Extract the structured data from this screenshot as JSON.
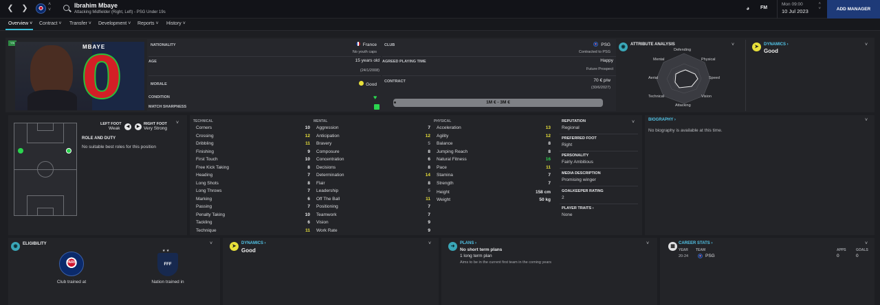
{
  "topbar": {
    "player_name": "Ibrahim Mbaye",
    "player_sub": "Attacking Midfielder (Right, Left) - PSG Under 19s",
    "fm_label": "FM",
    "date_day": "Mon 09:00",
    "date": "10 Jul 2023",
    "add_manager": "ADD MANAGER"
  },
  "menu": [
    "Overview",
    "Contract",
    "Transfer",
    "Development",
    "Reports",
    "History"
  ],
  "kit": {
    "name": "MBAYE",
    "number": "0",
    "badge": "Yth"
  },
  "info": {
    "nationality_label": "NATIONALITY",
    "nationality": "France",
    "nationality_sub": "No youth caps",
    "age_label": "AGE",
    "age": "15 years old",
    "dob": "(24/1/2008)",
    "morale_label": "MORALE",
    "morale": "Good",
    "condition_label": "CONDITION",
    "sharpness_label": "MATCH SHARPNESS",
    "club_label": "CLUB",
    "club": "PSG",
    "club_sub": "Contracted to PSG",
    "playing_time_label": "AGREED PLAYING TIME",
    "playing_time": "Happy",
    "playing_time_sub": "Future Prospect",
    "contract_label": "CONTRACT",
    "wage": "70 € p/w",
    "contract_end": "(30/6/2027)",
    "value_range": "1M € - 3M €"
  },
  "attribute_analysis": {
    "title": "ATTRIBUTE ANALYSIS",
    "labels": [
      "Defending",
      "Physical",
      "Speed",
      "Vision",
      "Attacking",
      "Technical",
      "Aerial",
      "Mental"
    ]
  },
  "dynamics_top": {
    "title": "DYNAMICS",
    "value": "Good"
  },
  "positions": {
    "left_foot_label": "LEFT FOOT",
    "left_foot": "Weak",
    "right_foot_label": "RIGHT FOOT",
    "right_foot": "Very Strong",
    "role_title": "ROLE AND DUTY",
    "role_text": "No suitable best roles for this position"
  },
  "technical": {
    "title": "TECHNICAL",
    "rows": [
      [
        "Corners",
        "10"
      ],
      [
        "Crossing",
        "12"
      ],
      [
        "Dribbling",
        "11"
      ],
      [
        "Finishing",
        "9"
      ],
      [
        "First Touch",
        "10"
      ],
      [
        "Free Kick Taking",
        "8"
      ],
      [
        "Heading",
        "7"
      ],
      [
        "Long Shots",
        "8"
      ],
      [
        "Long Throws",
        "7"
      ],
      [
        "Marking",
        "6"
      ],
      [
        "Passing",
        "7"
      ],
      [
        "Penalty Taking",
        "10"
      ],
      [
        "Tackling",
        "6"
      ],
      [
        "Technique",
        "11"
      ]
    ]
  },
  "mental": {
    "title": "MENTAL",
    "rows": [
      [
        "Aggression",
        "7"
      ],
      [
        "Anticipation",
        "12"
      ],
      [
        "Bravery",
        "5"
      ],
      [
        "Composure",
        "8"
      ],
      [
        "Concentration",
        "6"
      ],
      [
        "Decisions",
        "8"
      ],
      [
        "Determination",
        "14"
      ],
      [
        "Flair",
        "8"
      ],
      [
        "Leadership",
        "5"
      ],
      [
        "Off The Ball",
        "11"
      ],
      [
        "Positioning",
        "7"
      ],
      [
        "Teamwork",
        "7"
      ],
      [
        "Vision",
        "9"
      ],
      [
        "Work Rate",
        "9"
      ]
    ]
  },
  "physical": {
    "title": "PHYSICAL",
    "rows": [
      [
        "Acceleration",
        "13"
      ],
      [
        "Agility",
        "12"
      ],
      [
        "Balance",
        "8"
      ],
      [
        "Jumping Reach",
        "8"
      ],
      [
        "Natural Fitness",
        "16"
      ],
      [
        "Pace",
        "11"
      ],
      [
        "Stamina",
        "7"
      ],
      [
        "Strength",
        "7"
      ]
    ],
    "height_label": "Height",
    "height": "158 cm",
    "weight_label": "Weight",
    "weight": "50 kg"
  },
  "profile": {
    "reputation_label": "REPUTATION",
    "reputation": "Regional",
    "pref_foot_label": "PREFERRED FOOT",
    "pref_foot": "Right",
    "personality_label": "PERSONALITY",
    "personality": "Fairly Ambitious",
    "media_label": "MEDIA DESCRIPTION",
    "media": "Promising winger",
    "gk_label": "GOALKEEPER RATING",
    "gk": "2",
    "traits_label": "PLAYER TRAITS",
    "traits": "None"
  },
  "biography": {
    "title": "BIOGRAPHY",
    "text": "No biography is available at this time."
  },
  "eligibility": {
    "title": "ELIGIBILITY",
    "club_label": "Club trained at",
    "nation_label": "Nation trained in",
    "club_badge": "PARIS",
    "nation_badge": "FFF"
  },
  "dynamics_bottom": {
    "title": "DYNAMICS",
    "value": "Good"
  },
  "plans": {
    "title": "PLANS",
    "line1": "No short term plans",
    "line2": "1 long term plan",
    "line3": "Aims to be in the current first team in the coming years"
  },
  "career": {
    "title": "CAREER STATS",
    "year_head": "YEAR",
    "team_head": "TEAM",
    "apps_head": "APPS",
    "goals_head": "GOALS",
    "year": "20-24",
    "team": "PSG",
    "apps": "0",
    "goals": "0"
  },
  "colors": {
    "accent": "#3ac0d9",
    "yellow": "#e8e03a",
    "green": "#2bd54f",
    "kit_red": "#d31f26"
  }
}
